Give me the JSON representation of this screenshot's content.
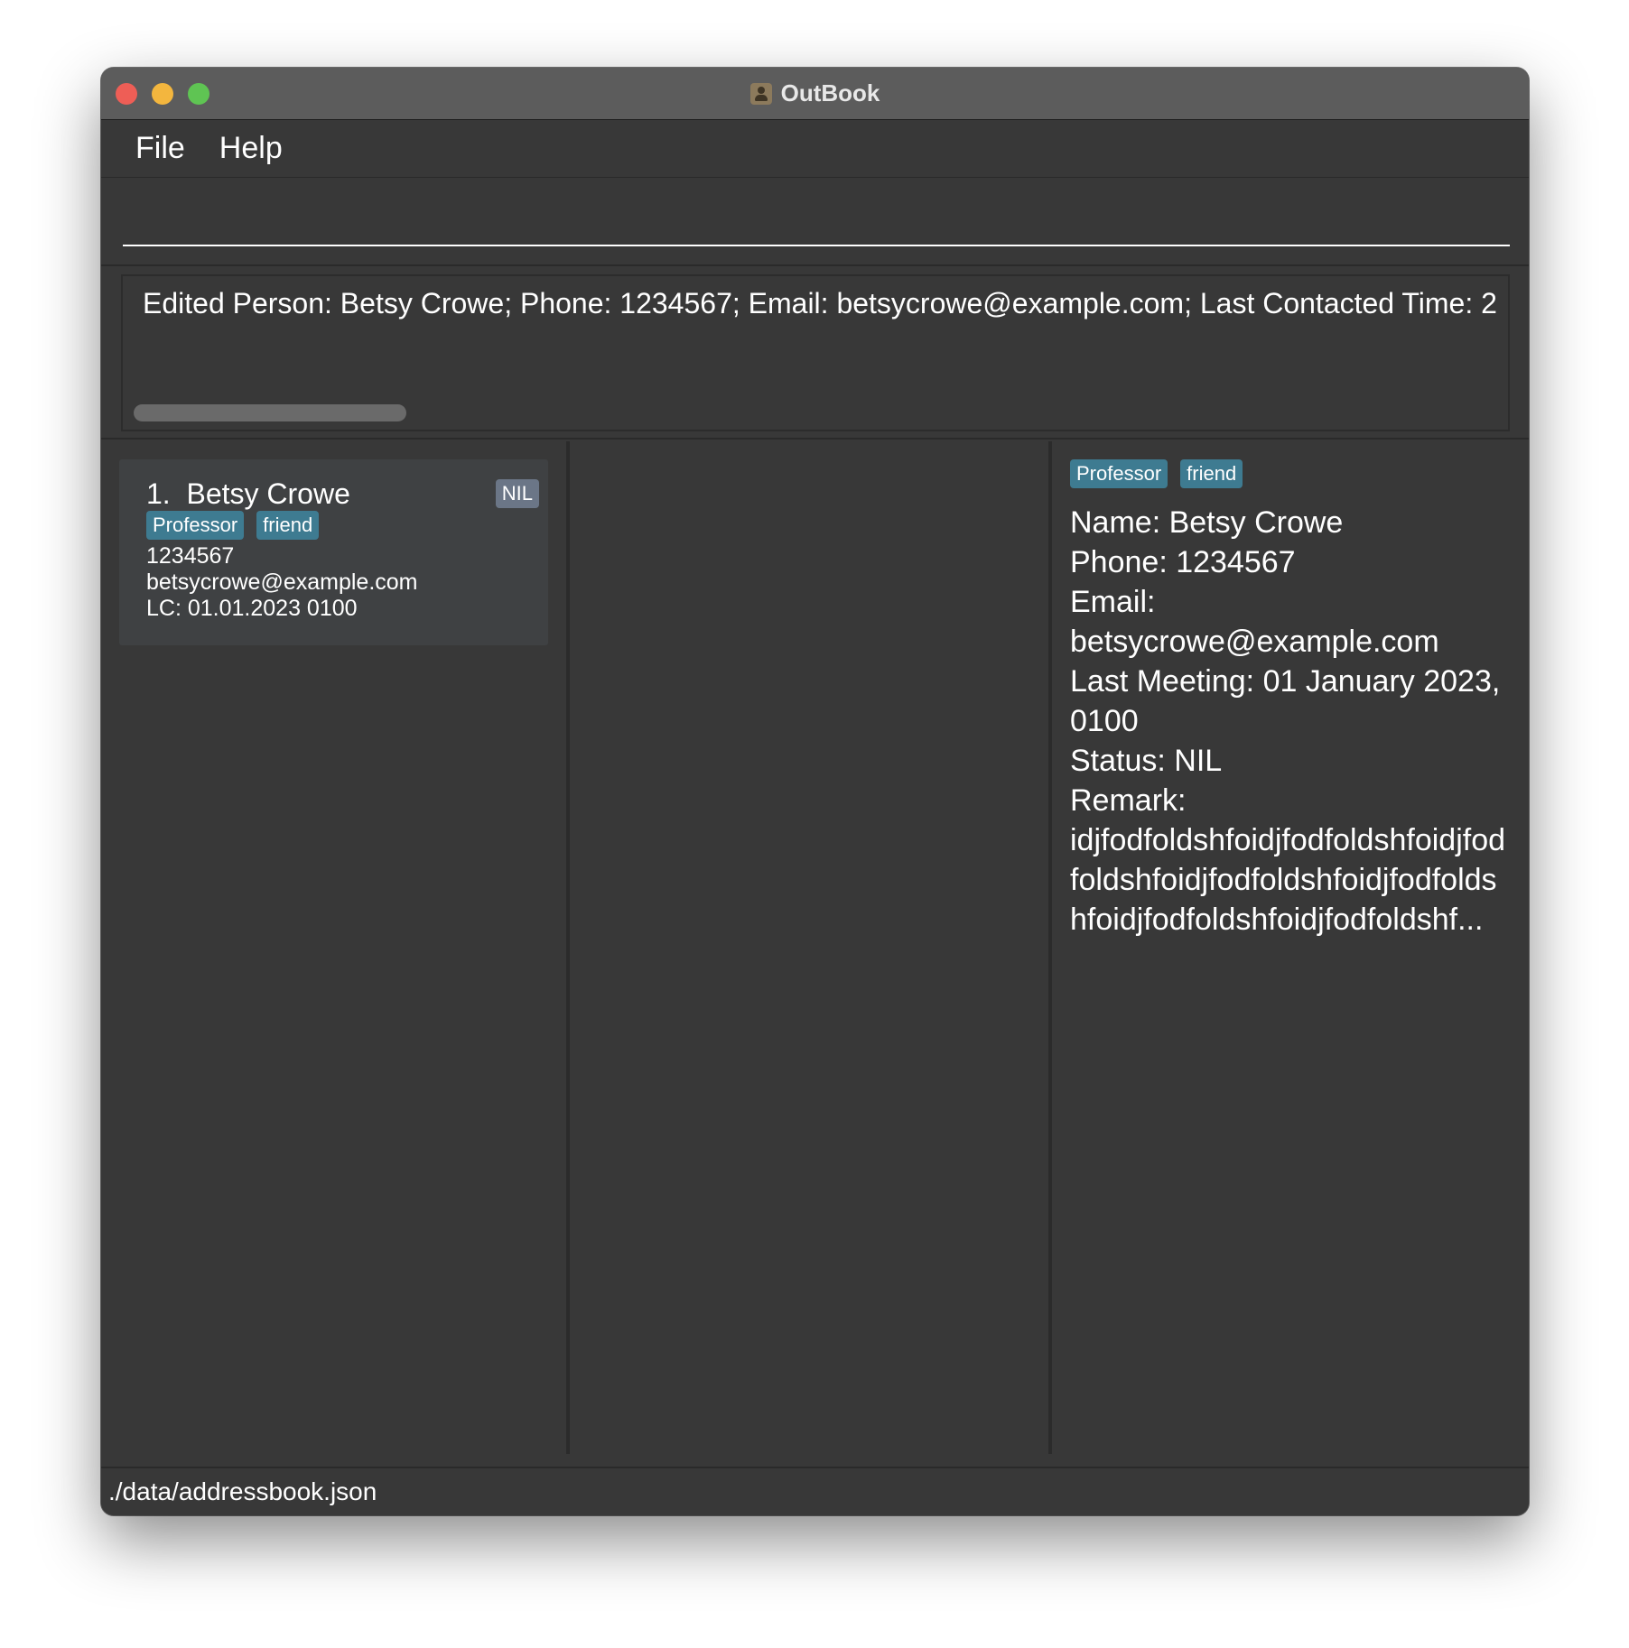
{
  "window": {
    "title": "OutBook",
    "app_icon": "address-book-icon"
  },
  "menu": {
    "items": [
      {
        "label": "File"
      },
      {
        "label": "Help"
      }
    ]
  },
  "command_box": {
    "value": "",
    "placeholder": ""
  },
  "result_display": {
    "text": "Edited Person: Betsy Crowe; Phone: 1234567; Email: betsycrowe@example.com; Last Contacted Time: 2"
  },
  "person_list": [
    {
      "index": "1.",
      "name": "Betsy Crowe",
      "status": "NIL",
      "tags": [
        "Professor",
        "friend"
      ],
      "phone": "1234567",
      "email": "betsycrowe@example.com",
      "last_contacted": "LC: 01.01.2023 0100"
    }
  ],
  "detail": {
    "tags": [
      "Professor",
      "friend"
    ],
    "name": "Name: Betsy Crowe",
    "phone": "Phone: 1234567",
    "email_label": "Email:",
    "email_value": "betsycrowe@example.com",
    "last_meeting": "Last Meeting: 01 January 2023, 0100",
    "status": "Status: NIL",
    "remark_label": "Remark:",
    "remark_value": "idjfodfoldshfoidjfodfoldshfoidjfodfoldshfoidjfodfoldshfoidjfodfoldshfoidjfodfoldshfoidjfodfoldshf..."
  },
  "status_bar": {
    "path": "./data/addressbook.json"
  },
  "colors": {
    "background": "#383838",
    "titlebar": "#5c5c5c",
    "tag": "#3e7b91",
    "status_badge": "#6b7687",
    "card": "#3f4143"
  }
}
